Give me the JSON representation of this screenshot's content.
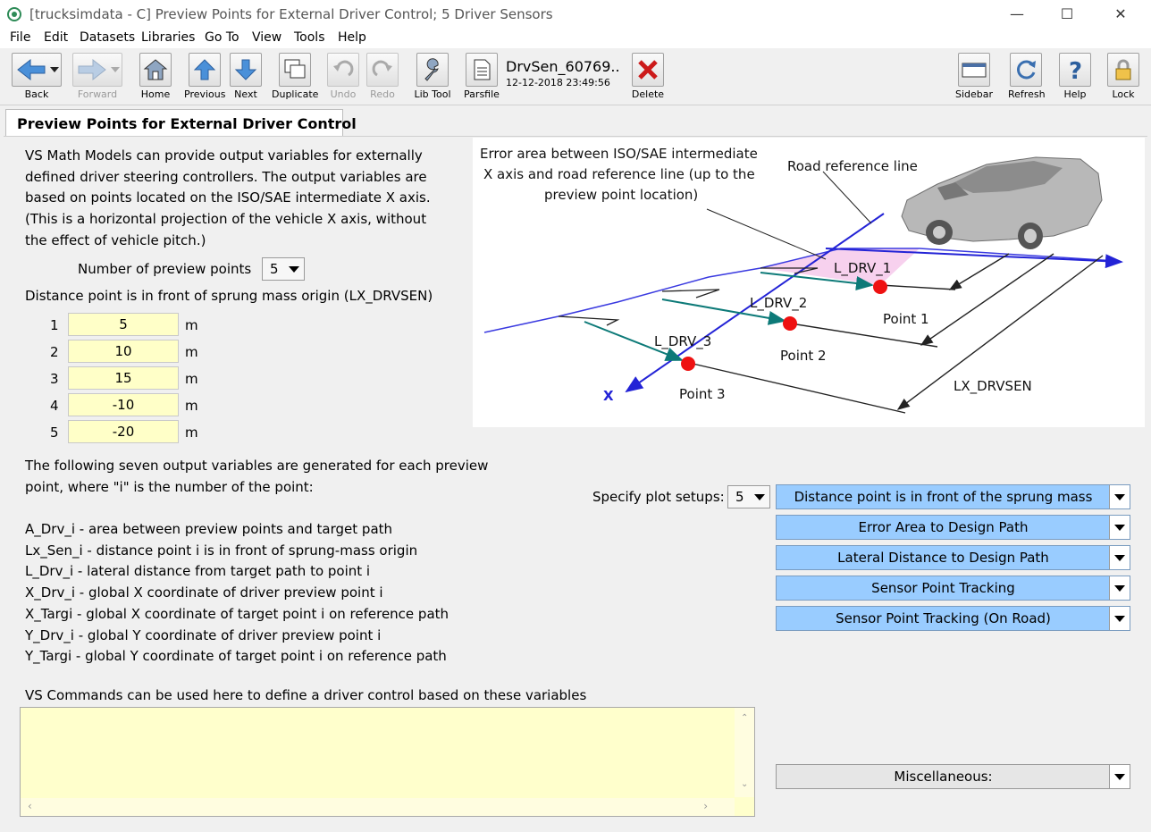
{
  "window": {
    "title": "[trucksimdata - C] Preview Points for External Driver Control; 5 Driver Sensors",
    "minimize": "—",
    "maximize": "☐",
    "close": "✕"
  },
  "menu": [
    "File",
    "Edit",
    "Datasets",
    "Libraries",
    "Go To",
    "View",
    "Tools",
    "Help"
  ],
  "toolbar": {
    "back": "Back",
    "forward": "Forward",
    "home": "Home",
    "previous": "Previous",
    "next": "Next",
    "duplicate": "Duplicate",
    "undo": "Undo",
    "redo": "Redo",
    "lib_tool": "Lib Tool",
    "parsfile": "Parsfile",
    "dataset_name": "DrvSen_60769..",
    "dataset_date": "12-12-2018 23:49:56",
    "delete": "Delete",
    "sidebar": "Sidebar",
    "refresh": "Refresh",
    "help": "Help",
    "lock": "Lock"
  },
  "tab": {
    "label": "Preview Points for External Driver Control"
  },
  "intro": [
    "VS Math Models can provide output variables for externally",
    "defined driver steering controllers. The output variables are",
    "based on points located on the ISO/SAE intermediate X axis.",
    "(This is a horizontal projection of the vehicle X axis, without",
    "the effect of vehicle pitch.)"
  ],
  "preview_points": {
    "label": "Number of preview points",
    "value": "5"
  },
  "distance": {
    "label": "Distance point is in front of sprung mass origin (LX_DRVSEN)",
    "unit": "m",
    "rows": [
      {
        "n": "1",
        "v": "5"
      },
      {
        "n": "2",
        "v": "10"
      },
      {
        "n": "3",
        "v": "15"
      },
      {
        "n": "4",
        "v": "-10"
      },
      {
        "n": "5",
        "v": "-20"
      }
    ]
  },
  "outputs_intro": [
    "The following seven output variables are generated for each preview",
    "point, where \"i\" is the number of the point:"
  ],
  "outputs": [
    "A_Drv_i - area between preview points and target path",
    "Lx_Sen_i - distance point i is in front of sprung-mass origin",
    "L_Drv_i - lateral distance from target path to point i",
    "X_Drv_i - global X coordinate of driver preview point i",
    "X_Targi - global X coordinate of target point i on reference path",
    "Y_Drv_i  - global Y coordinate of driver preview point i",
    "Y_Targi - global Y coordinate of target point i on reference path"
  ],
  "plot": {
    "label": "Specify plot setups:",
    "count": "5",
    "setups": [
      "Distance point is in front of the sprung mass",
      "Error Area to Design Path",
      "Lateral Distance to Design Path",
      "Sensor Point Tracking",
      "Sensor Point Tracking (On Road)"
    ]
  },
  "commands_label": "VS Commands can be used here to define a driver control based on these variables",
  "misc": "Miscellaneous:",
  "diagram": {
    "error_area": [
      "Error area between ISO/SAE intermediate",
      "X axis and road reference line (up to the",
      "preview point location)"
    ],
    "road_ref": "Road reference line",
    "l1": "L_DRV_1",
    "l2": "L_DRV_2",
    "l3": "L_DRV_3",
    "p1": "Point 1",
    "p2": "Point 2",
    "p3": "Point 3",
    "lx": "LX_DRVSEN",
    "x": "X"
  }
}
